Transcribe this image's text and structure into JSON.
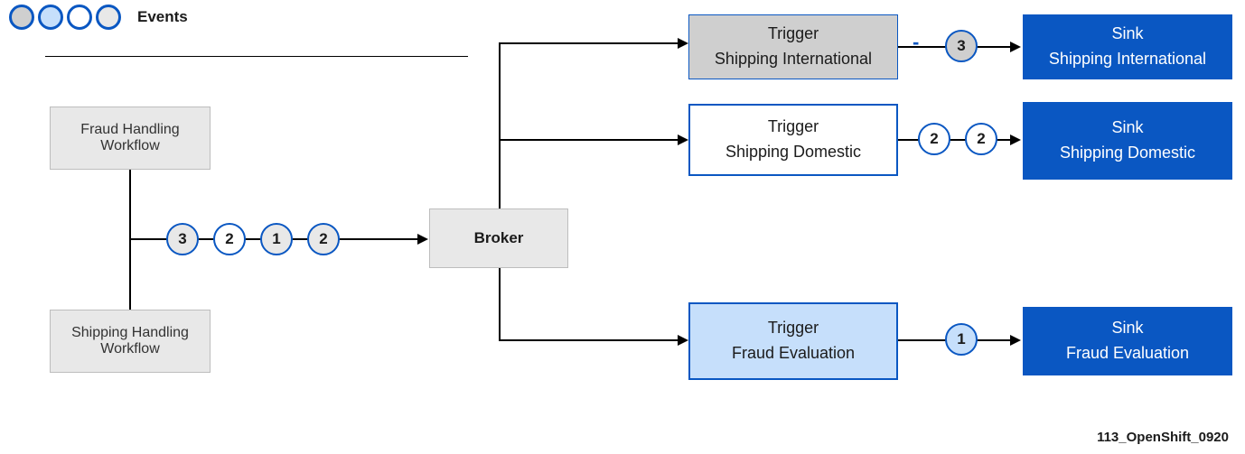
{
  "legend": {
    "label": "Events"
  },
  "workflows": {
    "fraud": "Fraud Handling\nWorkflow",
    "shipping": "Shipping Handling\nWorkflow"
  },
  "broker": {
    "label": "Broker"
  },
  "triggers": {
    "intl": {
      "line1": "Trigger",
      "line2": "Shipping International"
    },
    "dom": {
      "line1": "Trigger",
      "line2": "Shipping Domestic"
    },
    "fraud": {
      "line1": "Trigger",
      "line2": "Fraud Evaluation"
    }
  },
  "sinks": {
    "intl": {
      "line1": "Sink",
      "line2": "Shipping International"
    },
    "dom": {
      "line1": "Sink",
      "line2": "Shipping Domestic"
    },
    "fraud": {
      "line1": "Sink",
      "line2": "Fraud Evaluation"
    }
  },
  "events": {
    "pipeline": [
      "3",
      "2",
      "1",
      "2"
    ],
    "intl_out": "3",
    "dom_out_a": "2",
    "dom_out_b": "2",
    "fraud_out": "1"
  },
  "dash": "-",
  "caption": "113_OpenShift_0920"
}
